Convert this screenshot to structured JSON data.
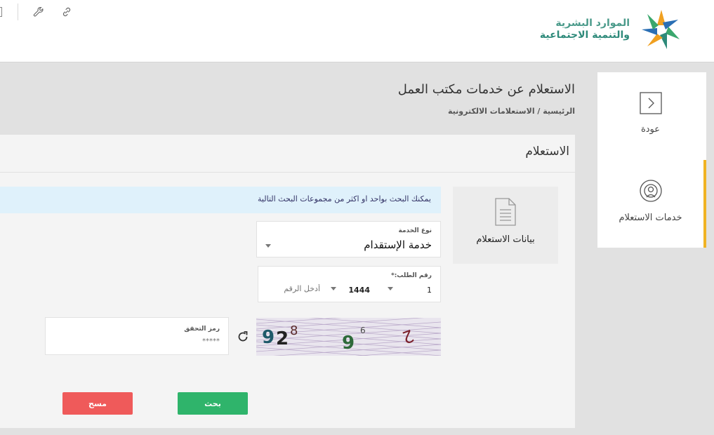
{
  "header": {
    "logo_line1": "الموارد البشرية",
    "logo_line2": "والتنمية الاجتماعية",
    "icons": [
      "link-icon",
      "wrench-icon"
    ],
    "colors": {
      "logo_green": "#2e8a7a",
      "logo_orange": "#f0a020",
      "logo_blue": "#2a6fb4"
    }
  },
  "sidenav": {
    "back_label": "عودة",
    "services_label": "خدمات الاستعلام",
    "active_color": "#f0b323"
  },
  "page": {
    "title": "الاستعلام عن خدمات مكتب العمل",
    "breadcrumb": "الرئيسية / الاستعلامات الالكترونية"
  },
  "card": {
    "title": "الاستعلام",
    "data_panel_label": "بيانات الاستعلام",
    "info_text": "يمكنك البحث بواحد او اكثر من مجموعات البحث التالية",
    "service_type": {
      "label": "نوع الخدمة",
      "value": "خدمة الإستقدام"
    },
    "request_number": {
      "label": "رقم الطلب:*",
      "year_prefix": "1",
      "number": "1444",
      "placeholder": "أدخل الرقم"
    },
    "captcha": {
      "text": "92896 2",
      "refresh_icon": "refresh-icon"
    },
    "verification_code": {
      "label": "رمز التحقق",
      "placeholder": "*****"
    },
    "search_button": "بحث",
    "clear_button": "مسح",
    "colors": {
      "search": "#2fb46b",
      "clear": "#ef5a5a",
      "info_bg": "#dff1fb"
    }
  }
}
